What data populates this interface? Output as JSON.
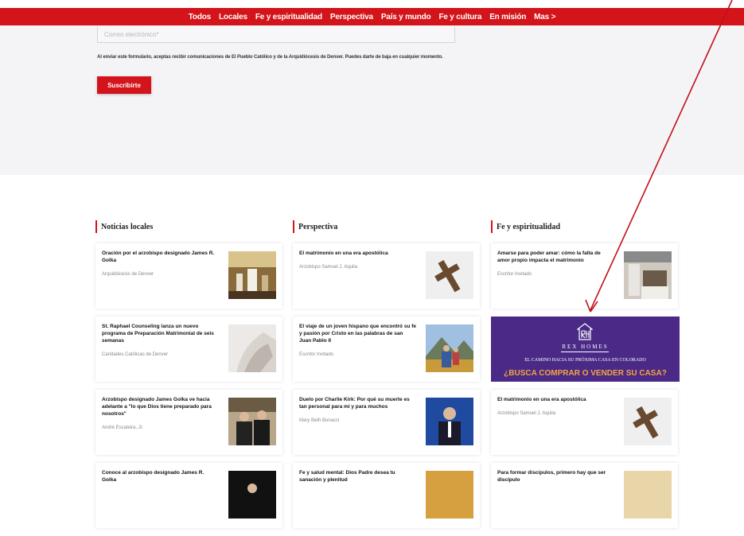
{
  "nav": {
    "items": [
      "Todos",
      "Locales",
      "Fe y espiritualidad",
      "Perspectiva",
      "País y mundo",
      "Fe y cultura",
      "En misión",
      "Mas >"
    ]
  },
  "form": {
    "email_placeholder": "Correo electrónico*",
    "consent": "Al enviar este formulario, aceptas recibir comunicaciones de El Pueblo Católico y de la Arquidiócesis de Denver. Puedes darte de baja en cualquier momento.",
    "subscribe_label": "Suscribirte"
  },
  "columns": [
    {
      "heading": "Noticias locales",
      "cards": [
        {
          "title": "Oración por el arzobispo designado James R. Golka",
          "author": "Arquidiócesis de Denver"
        },
        {
          "title": "St. Raphael Counseling lanza un nuevo programa de Preparación Matrimonial de seis semanas",
          "author": "Caridades Católicas de Denver"
        },
        {
          "title": "Arzobispo designado James Golka ve hacia adelante a \"lo que Dios tiene preparado para nosotros\"",
          "author": "André Escaleira, Jr."
        },
        {
          "title": "Conoce al arzobispo designado James R. Golka",
          "author": ""
        }
      ]
    },
    {
      "heading": "Perspectiva",
      "cards": [
        {
          "title": "El matrimonio en una era apostólica",
          "author": "Arzobispo Samuel J. Aquila"
        },
        {
          "title": "El viaje de un joven hispano que encontró su fe y pasión por Cristo en las palabras de san Juan Pablo II",
          "author": "Escritor Invitado"
        },
        {
          "title": "Duelo por Charlie Kirk: Por qué su muerte es tan personal para mí y para muchos",
          "author": "Mary Beth Bonacci"
        },
        {
          "title": "Fe y salud mental: Dios Padre desea tu sanación y plenitud",
          "author": ""
        }
      ]
    },
    {
      "heading": "Fe y espiritualidad",
      "cards": [
        {
          "title": "Amarse para poder amar: cómo la falta de amor propio impacta el matrimonio",
          "author": "Escritor Invitado"
        },
        {
          "title": "El matrimonio en una era apostólica",
          "author": "Arzobispo Samuel J. Aquila"
        },
        {
          "title": "Para formar discípulos, primero hay que ser discípulo",
          "author": ""
        }
      ]
    }
  ],
  "ad": {
    "brand": "REX HOMES",
    "subtitle": "EL CAMINO HACIA SU PRÓXIMA CASA EN COLORADO",
    "cta": "¿BUSCA COMPRAR O VENDER SU CASA?"
  },
  "colors": {
    "accent": "#d3141b",
    "ad_bg": "#4a2a86",
    "ad_cta": "#f5a540"
  }
}
